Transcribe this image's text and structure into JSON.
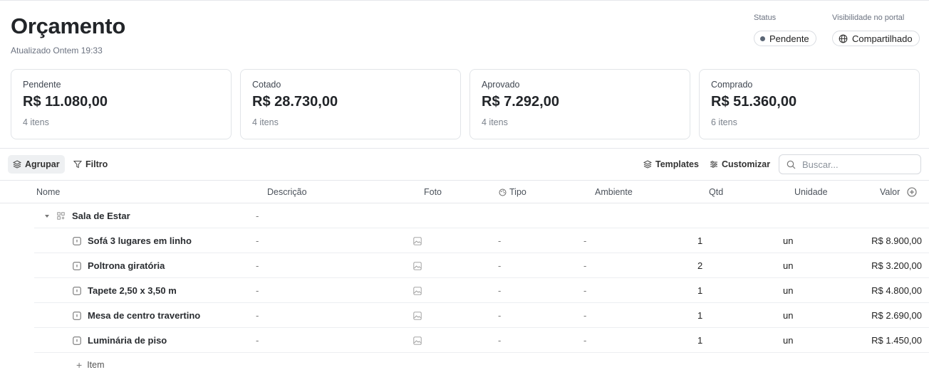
{
  "header": {
    "title": "Orçamento",
    "updated": "Atualizado Ontem 19:33",
    "status_label": "Status",
    "status_value": "Pendente",
    "visibility_label": "Visibilidade no portal",
    "visibility_value": "Compartilhado",
    "status_color": "#5b6675"
  },
  "summary": [
    {
      "label": "Pendente",
      "value": "R$ 11.080,00",
      "count": "4 itens"
    },
    {
      "label": "Cotado",
      "value": "R$ 28.730,00",
      "count": "4 itens"
    },
    {
      "label": "Aprovado",
      "value": "R$ 7.292,00",
      "count": "4 itens"
    },
    {
      "label": "Comprado",
      "value": "R$ 51.360,00",
      "count": "6 itens"
    }
  ],
  "toolbar": {
    "group_label": "Agrupar",
    "filter_label": "Filtro",
    "templates_label": "Templates",
    "customize_label": "Customizar",
    "search_placeholder": "Buscar..."
  },
  "table": {
    "columns": {
      "name": "Nome",
      "description": "Descrição",
      "photo": "Foto",
      "type": "Tipo",
      "room": "Ambiente",
      "qty": "Qtd",
      "unit": "Unidade",
      "value": "Valor"
    },
    "group": {
      "name": "Sala de Estar",
      "description": "-"
    },
    "rows": [
      {
        "name": "Sofá 3 lugares em linho",
        "description": "-",
        "type": "-",
        "room": "-",
        "qty": "1",
        "unit": "un",
        "value": "R$ 8.900,00"
      },
      {
        "name": "Poltrona giratória",
        "description": "-",
        "type": "-",
        "room": "-",
        "qty": "2",
        "unit": "un",
        "value": "R$ 3.200,00"
      },
      {
        "name": "Tapete 2,50 x 3,50 m",
        "description": "-",
        "type": "-",
        "room": "-",
        "qty": "1",
        "unit": "un",
        "value": "R$ 4.800,00"
      },
      {
        "name": "Mesa de centro travertino",
        "description": "-",
        "type": "-",
        "room": "-",
        "qty": "1",
        "unit": "un",
        "value": "R$ 2.690,00"
      },
      {
        "name": "Luminária de piso",
        "description": "-",
        "type": "-",
        "room": "-",
        "qty": "1",
        "unit": "un",
        "value": "R$ 1.450,00"
      }
    ],
    "add_item_label": "Item"
  }
}
